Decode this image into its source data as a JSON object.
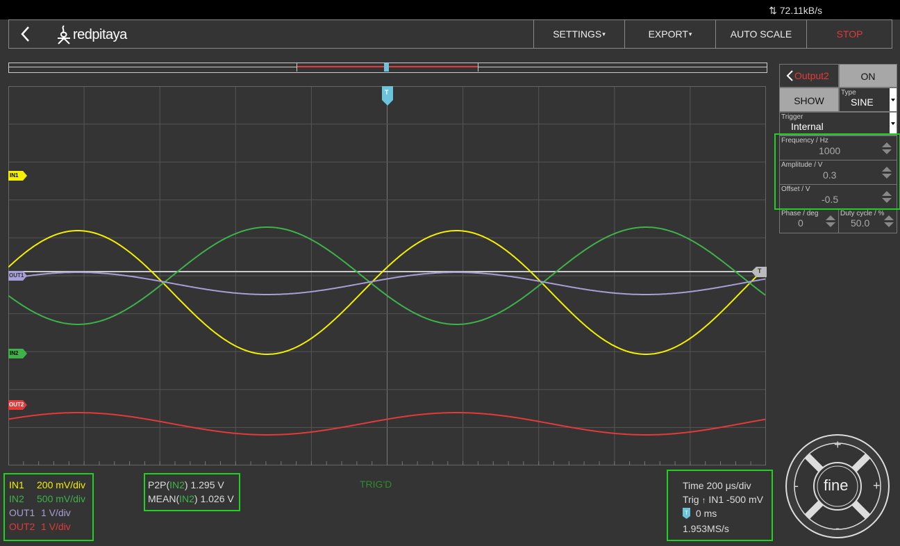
{
  "status": {
    "net_speed": "72.11kB/s"
  },
  "brand": {
    "logo_text": "redpitaya"
  },
  "nav": {
    "settings": "SETTINGS",
    "export": "EXPORT",
    "autoscale": "AUTO SCALE",
    "stop": "STOP"
  },
  "plot": {
    "trigger_marker": "T",
    "channel_markers": {
      "in1": "IN1",
      "out1": "OUT1",
      "in2": "IN2",
      "out2": "OUT2"
    },
    "trig_status": "TRIG'D"
  },
  "colors": {
    "in1": "#f4f000",
    "in2": "#3db34a",
    "out1": "#a79fd7",
    "out2": "#e33a3a",
    "highlight": "#1fd21f",
    "trigger": "#6cc4dc"
  },
  "output_panel": {
    "title": "Output2",
    "on_label": "ON",
    "show_label": "SHOW",
    "type_label": "Type",
    "type_value": "SINE",
    "trigger_label": "Trigger",
    "trigger_value": "Internal",
    "frequency_label": "Frequency / Hz",
    "frequency_value": "1000",
    "amplitude_label": "Amplitude / V",
    "amplitude_value": "0.3",
    "offset_label": "Offset / V",
    "offset_value": "-0.5",
    "phase_label": "Phase / deg",
    "phase_value": "0",
    "duty_label": "Duty cycle / %",
    "duty_value": "50.0"
  },
  "scales": [
    {
      "name": "IN1",
      "value": "200 mV/div",
      "color": "#f4f000"
    },
    {
      "name": "IN2",
      "value": "500 mV/div",
      "color": "#3db34a"
    },
    {
      "name": "OUT1",
      "value": "1 V/div",
      "color": "#a79fd7"
    },
    {
      "name": "OUT2",
      "value": "1 V/div",
      "color": "#e33a3a"
    }
  ],
  "measurements": {
    "p2p_label": "P2P(",
    "p2p_channel": "IN2",
    "p2p_value": ") 1.295 V",
    "mean_label": "MEAN(",
    "mean_channel": "IN2",
    "mean_value": ") 1.026 V"
  },
  "timing": {
    "time": "Time 200 μs/div",
    "trig_prefix": "Trig",
    "trig_value": "IN1 -500 mV",
    "trigger_pos": "0 ms",
    "sample_rate": "1.953MS/s"
  },
  "joystick": {
    "center": "fine",
    "plus": "+",
    "minus": "-"
  }
}
